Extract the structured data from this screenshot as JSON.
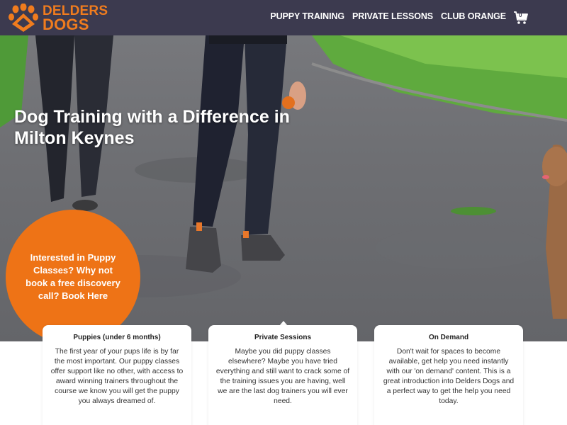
{
  "brand": {
    "line1": "DELDERS",
    "line2": "DOGS",
    "accent": "#f07c1e",
    "header_bg": "#3c3a4f"
  },
  "nav": {
    "items": [
      {
        "label": "PUPPY TRAINING"
      },
      {
        "label": "PRIVATE LESSONS"
      },
      {
        "label": "CLUB ORANGE"
      }
    ],
    "cart_count": "0",
    "cart_icon": "shopping-cart-icon"
  },
  "hero": {
    "title": "Dog Training with a Difference in Milton Keynes"
  },
  "cta": {
    "text": "Interested in Puppy Classes? Why not book a free discovery call? Book Here",
    "color": "#ee7316"
  },
  "cards": [
    {
      "title": "Puppies (under 6 months)",
      "body": "The first year of your pups life is by far the most important. Our puppy classes offer support like no other, with access to award winning trainers throughout the course we know you will get the puppy you always dreamed of."
    },
    {
      "title": "Private Sessions",
      "body": "Maybe you did puppy classes elsewhere? Maybe you have tried everything and still want to crack some of the training issues you are having, well we are the last dog trainers you will ever need."
    },
    {
      "title": "On Demand",
      "body": "Don't wait for spaces to become available, get help you need instantly with our 'on demand' content. This is a great introduction into Delders Dogs and a perfect way to get the help you need today."
    }
  ]
}
